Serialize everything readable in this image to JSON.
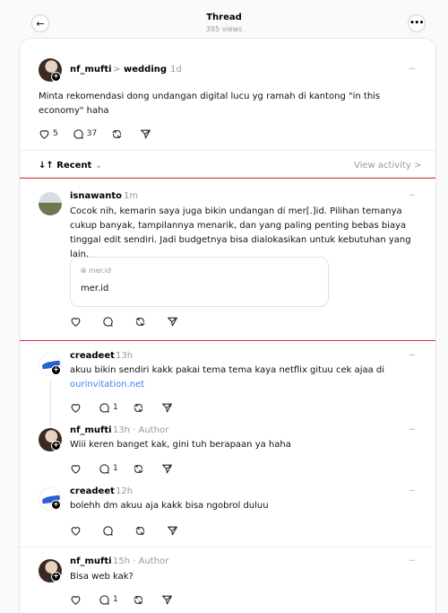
{
  "header": {
    "title": "Thread",
    "views": "395 views"
  },
  "icons": {
    "back": "arrow-left-icon",
    "more": "ellipsis-icon",
    "like": "heart-icon",
    "reply": "comment-icon",
    "repost": "repost-icon",
    "share": "send-icon"
  },
  "original_post": {
    "username": "nf_mufti",
    "separator": ">",
    "community": "wedding",
    "time": "1d",
    "text": "Minta rekomendasi dong undangan digital lucu yg ramah di kantong \"in this economy\" haha",
    "likes": "5",
    "replies": "37"
  },
  "sort": {
    "label": "Recent",
    "view_activity": "View activity >"
  },
  "replies": [
    {
      "username": "isnawanto",
      "time": "1m",
      "text": "Cocok nih, kemarin saya juga bikin undangan di mer[.]id. Pilihan temanya cukup banyak, tampilannya menarik, dan yang paling penting bebas biaya tinggal edit sendiri. Jadi budgetnya bisa dialokasikan untuk kebutuhan yang lain.",
      "link_preview": {
        "domain": "mer.id",
        "title": "mer.id"
      }
    },
    {
      "username": "creadeet",
      "time": "13h",
      "text": "akuu bikin sendiri kakk pakai tema tema kaya netflix gituu cek ajaa di",
      "link_text": "ourinvitation.net",
      "reply_count": "1"
    },
    {
      "username": "nf_mufti",
      "time": "13h",
      "author_tag": "Author",
      "text": "Wiii keren banget kak, gini tuh berapaan ya haha",
      "reply_count": "1"
    },
    {
      "username": "creadeet",
      "time": "12h",
      "text": "bolehh dm akuu aja kakk bisa ngobrol duluu"
    },
    {
      "username": "nf_mufti",
      "time": "15h",
      "author_tag": "Author",
      "text": "Bisa web kak?",
      "reply_count": "1"
    }
  ],
  "highlight_color": "#e0323c",
  "link_color": "#3b82f6"
}
